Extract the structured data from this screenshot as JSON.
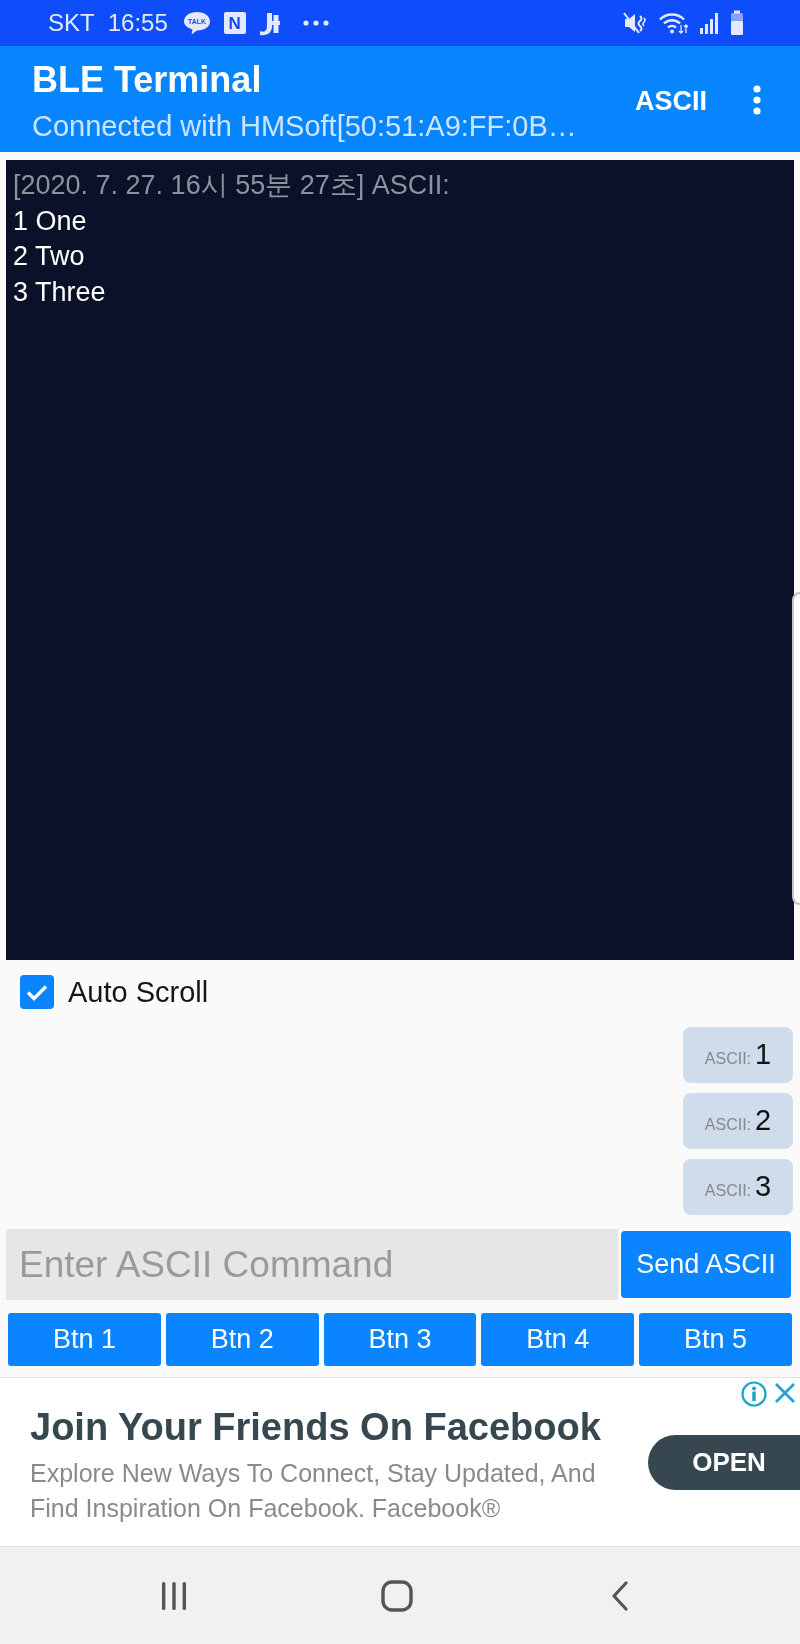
{
  "status_bar": {
    "carrier": "SKT",
    "time": "16:55",
    "notifications": [
      {
        "kind": "talk",
        "text": "TALK"
      },
      {
        "kind": "letter",
        "text": "N"
      },
      {
        "kind": "app"
      },
      {
        "kind": "more"
      }
    ]
  },
  "app_bar": {
    "title": "BLE Terminal",
    "subtitle": "Connected with HMSoft[50:51:A9:FF:0B…",
    "action": "ASCII"
  },
  "terminal": {
    "lines": [
      {
        "kind": "timestamp",
        "text": "[2020. 7. 27. 16시 55분 27초] ASCII:"
      },
      {
        "kind": "data",
        "text": "1 One"
      },
      {
        "kind": "data",
        "text": "2 Two"
      },
      {
        "kind": "data",
        "text": "3 Three"
      }
    ]
  },
  "auto_scroll": {
    "label": "Auto Scroll",
    "checked": true
  },
  "quick_commands": [
    {
      "prefix": "ASCII:",
      "value": "1"
    },
    {
      "prefix": "ASCII:",
      "value": "2"
    },
    {
      "prefix": "ASCII:",
      "value": "3"
    }
  ],
  "command_input": {
    "placeholder": "Enter ASCII Command"
  },
  "send_button": "Send ASCII",
  "buttons": [
    "Btn 1",
    "Btn 2",
    "Btn 3",
    "Btn 4",
    "Btn 5"
  ],
  "ad": {
    "title": "Join Your Friends On Facebook",
    "description": "Explore New Ways To Connect, Stay Updated, And Find Inspiration On Facebook. Facebook®",
    "button": "OPEN"
  }
}
